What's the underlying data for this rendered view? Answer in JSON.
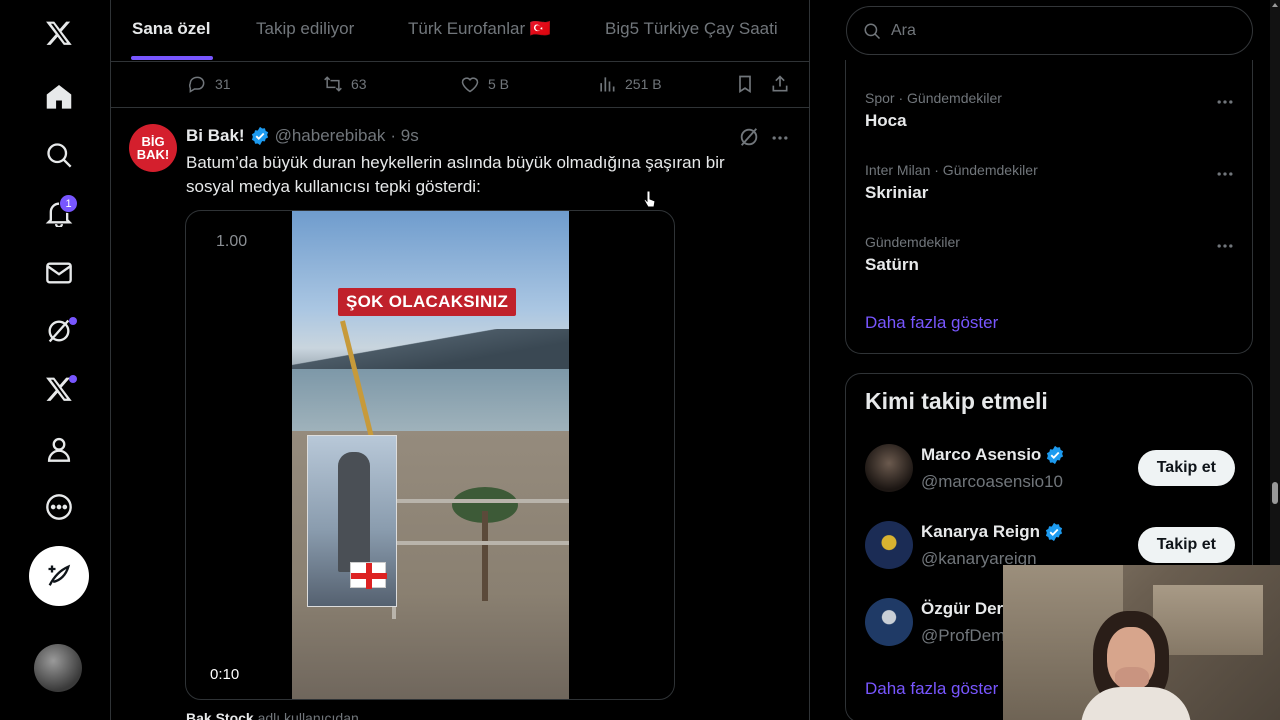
{
  "nav": {
    "notifications_badge": "1",
    "items": [
      "x-logo",
      "home",
      "explore",
      "notifications",
      "messages",
      "grok",
      "premium",
      "profile",
      "more"
    ]
  },
  "tabs": [
    {
      "label": "Sana özel",
      "active": true
    },
    {
      "label": "Takip ediliyor",
      "active": false
    },
    {
      "label": "Türk Eurofanlar 🇹🇷",
      "active": false
    },
    {
      "label": "Big5 Türkiye Çay Saati",
      "active": false
    }
  ],
  "prev_actions": {
    "replies": "31",
    "reposts": "63",
    "likes": "5 B",
    "views": "251 B"
  },
  "tweet": {
    "avatar_text_line1": "BİG",
    "avatar_text_line2": "BAK!",
    "name": "Bi Bak!",
    "handle": "@haberebibak",
    "time": "· 9s",
    "text": "Batum’da büyük duran heykellerin aslında büyük olmadığına şaşıran bir sosyal medya kullanıcısı tepki gösterdi:",
    "video": {
      "speed": "1.00",
      "overlay_text": "ŞOK OLACAKSINIZ",
      "time": "0:10"
    },
    "credit_user": "Bak Stock",
    "credit_suffix": " adlı kullanıcıdan"
  },
  "search": {
    "placeholder": "Ara"
  },
  "trends": [
    {
      "meta": "Spor · Gündemdekiler",
      "name": "Hoca"
    },
    {
      "meta": "Inter Milan · Gündemdekiler",
      "name": "Skriniar"
    },
    {
      "meta": "Gündemdekiler",
      "name": "Satürn"
    }
  ],
  "trends_show_more": "Daha fazla göster",
  "who_to_follow": {
    "title": "Kimi takip etmeli",
    "users": [
      {
        "name": "Marco Asensio",
        "handle": "@marcoasensio10",
        "button": "Takip et",
        "verified": true
      },
      {
        "name": "Kanarya Reign",
        "handle": "@kanaryareign",
        "button": "Takip et",
        "verified": true
      },
      {
        "name": "Özgür Der",
        "handle": "@ProfDem",
        "button": "",
        "verified": false
      }
    ],
    "show_more": "Daha fazla göster"
  },
  "colors": {
    "accent": "#7856ff",
    "verified": "#1d9bf0",
    "text": "#e7e9ea",
    "muted": "#71767b",
    "border": "#2f3336"
  }
}
